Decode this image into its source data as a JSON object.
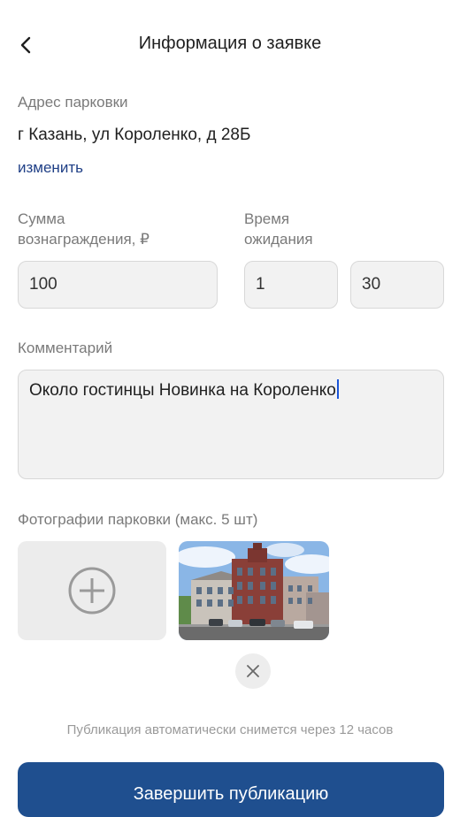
{
  "header": {
    "title": "Информация о заявке",
    "back_icon": "chevron-left-icon"
  },
  "address": {
    "label": "Адрес парковки",
    "value": "г Казань, ул Короленко, д 28Б",
    "change_link": "изменить"
  },
  "reward": {
    "label_line1": "Сумма",
    "label_line2": "вознаграждения, ₽",
    "value": "100"
  },
  "wait_time": {
    "label_line1": "Время",
    "label_line2": "ожидания",
    "hours": "1",
    "minutes": "30"
  },
  "comment": {
    "label": "Комментарий",
    "value": "Около гостинцы Новинка на Короленко"
  },
  "photos": {
    "label": "Фотографии парковки (макс. 5 шт)",
    "add_icon": "plus-circle-icon",
    "remove_icon": "close-icon",
    "count": 1
  },
  "note": "Публикация автоматически снимется через 12 часов",
  "finish_button": "Завершить публикацию",
  "colors": {
    "accent": "#1f4f8f",
    "link": "#1f3f86",
    "field_bg": "#f2f2f2"
  }
}
